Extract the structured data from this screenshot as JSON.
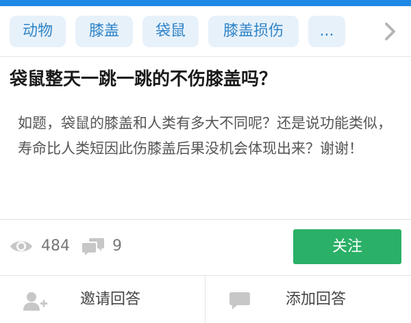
{
  "tags": [
    "动物",
    "膝盖",
    "袋鼠",
    "膝盖损伤",
    "..."
  ],
  "question": {
    "title": "袋鼠整天一跳一跳的不伤膝盖吗？",
    "description": "如题，袋鼠的膝盖和人类有多大不同呢？还是说功能类似，寿命比人类短因此伤膝盖后果没机会体现出来？谢谢！"
  },
  "stats": {
    "views": "484",
    "comments": "9"
  },
  "follow_label": "关注",
  "actions": {
    "invite_label": "邀请回答",
    "add_answer_label": "添加回答"
  },
  "colors": {
    "accent_blue": "#1e88e5",
    "tag_bg": "#e7f1fa",
    "tag_text": "#2f84c8",
    "follow_green": "#2ab067"
  },
  "icons": [
    "chevron-right-icon",
    "eye-icon",
    "comment-icon",
    "add-user-icon",
    "speech-bubble-icon"
  ]
}
